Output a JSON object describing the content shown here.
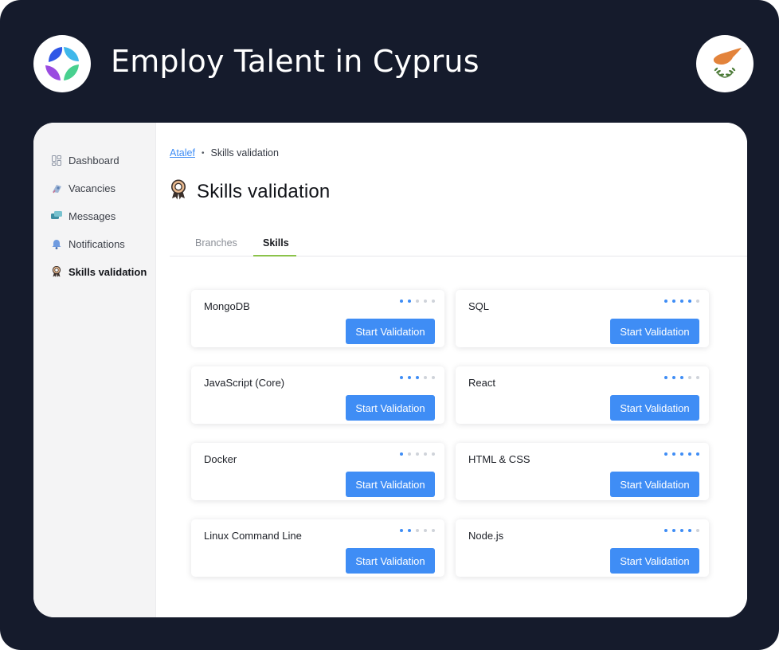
{
  "hero": {
    "title": "Employ Talent in Cyprus",
    "logo_icon": "logo-icon",
    "flag_icon": "cyprus-flag-icon"
  },
  "colors": {
    "frame_bg": "#151b2c",
    "accent": "#3f8df5",
    "tab_active_underline": "#8bc34a",
    "cyprus_orange": "#e3833b",
    "olive_green": "#4e7c3a"
  },
  "sidebar": {
    "items": [
      {
        "label": "Dashboard",
        "icon": "dashboard-icon",
        "active": false
      },
      {
        "label": "Vacancies",
        "icon": "vacancies-icon",
        "active": false
      },
      {
        "label": "Messages",
        "icon": "messages-icon",
        "active": false
      },
      {
        "label": "Notifications",
        "icon": "bell-icon",
        "active": false
      },
      {
        "label": "Skills validation",
        "icon": "award-icon",
        "active": true
      }
    ]
  },
  "breadcrumb": {
    "link": "Atalef",
    "separator": "•",
    "current": "Skills validation"
  },
  "page": {
    "title": "Skills validation",
    "title_icon": "award-icon"
  },
  "tabs": [
    {
      "label": "Branches",
      "active": false
    },
    {
      "label": "Skills",
      "active": true
    }
  ],
  "skills": [
    {
      "name": "MongoDB",
      "level": 2,
      "max_level": 5,
      "button": "Start Validation"
    },
    {
      "name": "SQL",
      "level": 4,
      "max_level": 5,
      "button": "Start Validation"
    },
    {
      "name": "JavaScript (Core)",
      "level": 3,
      "max_level": 5,
      "button": "Start Validation"
    },
    {
      "name": "React",
      "level": 3,
      "max_level": 5,
      "button": "Start Validation"
    },
    {
      "name": "Docker",
      "level": 1,
      "max_level": 5,
      "button": "Start Validation"
    },
    {
      "name": "HTML & CSS",
      "level": 5,
      "max_level": 5,
      "button": "Start Validation"
    },
    {
      "name": "Linux Command Line",
      "level": 2,
      "max_level": 5,
      "button": "Start Validation"
    },
    {
      "name": "Node.js",
      "level": 4,
      "max_level": 5,
      "button": "Start Validation"
    }
  ]
}
